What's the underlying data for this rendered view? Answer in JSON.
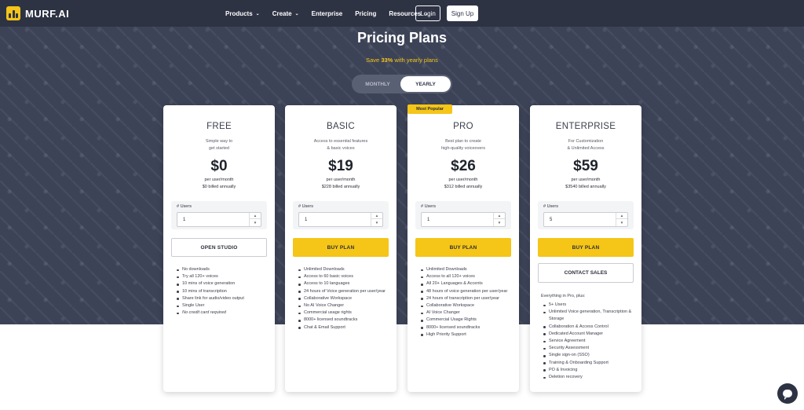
{
  "nav": {
    "logo_text": "MURF.AI",
    "links": [
      {
        "label": "Products",
        "has_dropdown": true
      },
      {
        "label": "Create",
        "has_dropdown": true
      },
      {
        "label": "Enterprise",
        "has_dropdown": false
      },
      {
        "label": "Pricing",
        "has_dropdown": false
      },
      {
        "label": "Resources",
        "has_dropdown": true
      }
    ],
    "login_label": "Login",
    "signup_label": "Sign Up",
    "dropdown_icon": "⌄"
  },
  "hero": {
    "title": "Pricing Plans",
    "save_prefix": "Save ",
    "save_percent": "33%",
    "save_suffix": " with yearly plans",
    "toggle_monthly": "MONTHLY",
    "toggle_yearly": "YEARLY",
    "toggle_selected": "YEARLY"
  },
  "plans": [
    {
      "name": "FREE",
      "desc_line1": "Simple way to",
      "desc_line2": "get started",
      "price": "$0",
      "per": "per user/month",
      "billed": "$0 billed annually",
      "users_label": "# Users",
      "users_value": "1",
      "cta": "OPEN STUDIO",
      "features": [
        "No downloads",
        "Try all 120+ voices",
        "10 mins of voice generation",
        "10 mins of transcription",
        "Share link for audio/video output",
        "Single User",
        "No credit card required"
      ]
    },
    {
      "name": "BASIC",
      "desc_line1": "Access to essential features",
      "desc_line2": "& basic voices",
      "price": "$19",
      "per": "per user/month",
      "billed": "$228 billed annually",
      "users_label": "# Users",
      "users_value": "1",
      "cta": "BUY PLAN",
      "features": [
        "Unlimited Downloads",
        "Access to 60 basic voices",
        "Access to 10 languages",
        "24 hours of Voice generation per user/year",
        "Collaborative Workspace",
        "No AI Voice Changer",
        "Commercial usage rights",
        "8000+ licensed soundtracks",
        "Chat & Email Support"
      ]
    },
    {
      "name": "PRO",
      "badge": "Most Popular",
      "desc_line1": "Best plan to create",
      "desc_line2": "high-quality voiceovers",
      "price": "$26",
      "per": "per user/month",
      "billed": "$312 billed annually",
      "users_label": "# Users",
      "users_value": "1",
      "cta": "BUY PLAN",
      "features": [
        "Unlimited Downloads",
        "Access to all 120+ voices",
        "All 20+ Languages & Accents",
        "48 hours of voice generation per user/year",
        "24 hours of transcription per user/year",
        "Collaborative Workspace",
        "AI Voice Changer",
        "Commercial Usage Rights",
        "8000+ licensed soundtracks",
        "High Priority Support"
      ]
    },
    {
      "name": "ENTERPRISE",
      "desc_line1": "For Customization",
      "desc_line2": "& Unlimited Access",
      "price": "$59",
      "per": "per user/month",
      "billed": "$3540 billed annually",
      "users_label": "# Users",
      "users_value": "5",
      "cta": "BUY PLAN",
      "cta2": "CONTACT SALES",
      "features_intro": "Everything in Pro, plus:",
      "features": [
        "5+ Users",
        "Unlimited Voice generation, Transcription & Storage",
        "Collaboration & Access Control",
        "Dedicated Account Manager",
        "Service Agreement",
        "Security Assessment",
        "Single sign-on (SSO)",
        "Training & Onboarding Support",
        "PO & Invoicing",
        "Deletion recovery"
      ]
    }
  ],
  "stepper": {
    "up_icon": "▲",
    "down_icon": "▼"
  }
}
